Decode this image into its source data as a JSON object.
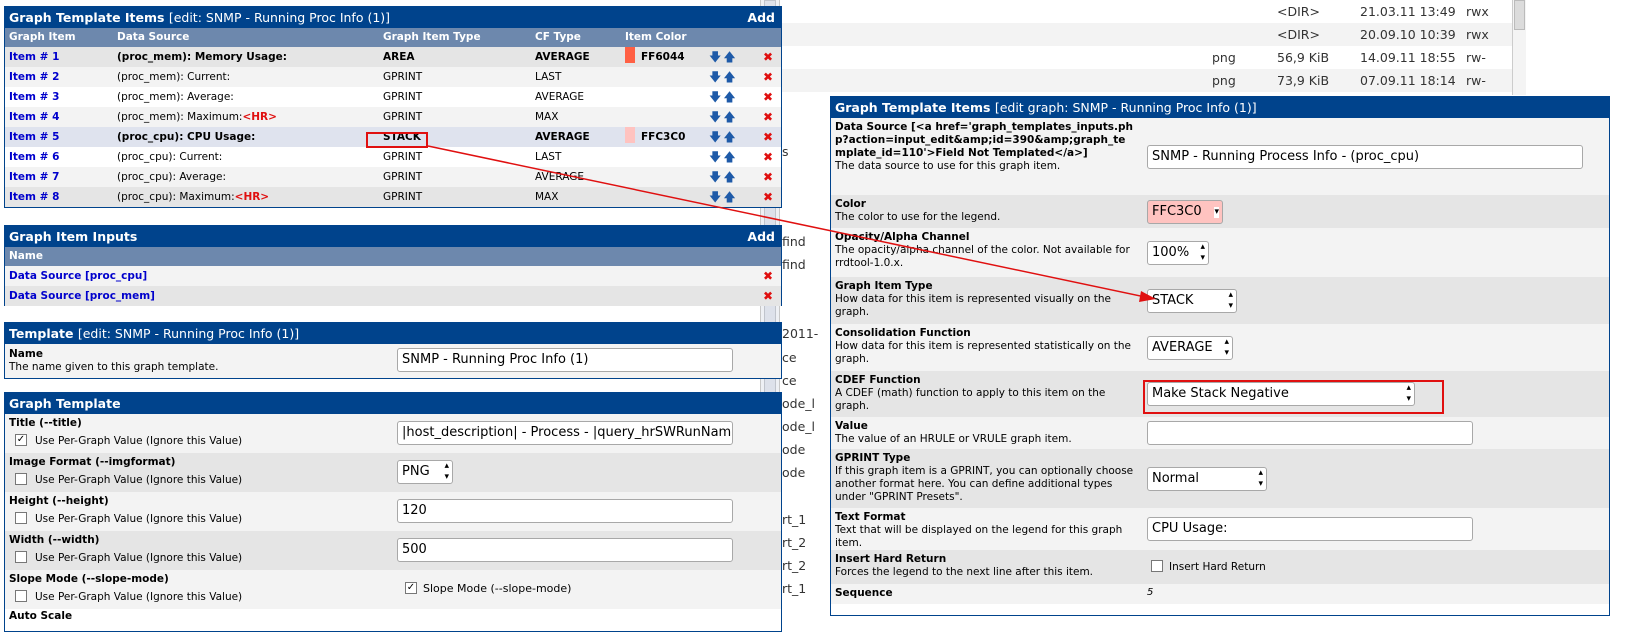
{
  "items_panel": {
    "title": "Graph Template Items",
    "subtitle": "[edit: SNMP - Running Proc Info (1)]",
    "add_label": "Add",
    "columns": [
      "Graph Item",
      "Data Source",
      "Graph Item Type",
      "CF Type",
      "Item Color"
    ],
    "rows": [
      {
        "item": "Item # 1",
        "source": "(proc_mem): Memory Usage:",
        "hr": "",
        "type": "AREA",
        "cf": "AVERAGE",
        "color": "FF6044",
        "swatch": "#ff6044"
      },
      {
        "item": "Item # 2",
        "source": "(proc_mem): Current:",
        "hr": "",
        "type": "GPRINT",
        "cf": "LAST",
        "color": "",
        "swatch": ""
      },
      {
        "item": "Item # 3",
        "source": "(proc_mem): Average:",
        "hr": "",
        "type": "GPRINT",
        "cf": "AVERAGE",
        "color": "",
        "swatch": ""
      },
      {
        "item": "Item # 4",
        "source": "(proc_mem): Maximum:",
        "hr": "<HR>",
        "type": "GPRINT",
        "cf": "MAX",
        "color": "",
        "swatch": ""
      },
      {
        "item": "Item # 5",
        "source": "(proc_cpu): CPU Usage:",
        "hr": "",
        "type": "STACK",
        "cf": "AVERAGE",
        "color": "FFC3C0",
        "swatch": "#ffc3c0"
      },
      {
        "item": "Item # 6",
        "source": "(proc_cpu): Current:",
        "hr": "",
        "type": "GPRINT",
        "cf": "LAST",
        "color": "",
        "swatch": ""
      },
      {
        "item": "Item # 7",
        "source": "(proc_cpu): Average:",
        "hr": "",
        "type": "GPRINT",
        "cf": "AVERAGE",
        "color": "",
        "swatch": ""
      },
      {
        "item": "Item # 8",
        "source": "(proc_cpu): Maximum:",
        "hr": "<HR>",
        "type": "GPRINT",
        "cf": "MAX",
        "color": "",
        "swatch": ""
      }
    ]
  },
  "inputs_panel": {
    "title": "Graph Item Inputs",
    "add_label": "Add",
    "col_name": "Name",
    "rows": [
      "Data Source [proc_cpu]",
      "Data Source [proc_mem]"
    ]
  },
  "template_panel": {
    "title": "Template",
    "subtitle": "[edit: SNMP - Running Proc Info (1)]",
    "name_label": "Name",
    "name_desc": "The name given to this graph template.",
    "name_value": "SNMP - Running Proc Info (1)"
  },
  "graph_template_panel": {
    "title": "Graph Template",
    "use_per_graph": "Use Per-Graph Value (Ignore this Value)",
    "fields": [
      {
        "label": "Title (--title)",
        "checked": "✓",
        "value": "|host_description| - Process - |query_hrSWRunName"
      },
      {
        "label": "Image Format (--imgformat)",
        "checked": "",
        "value": "PNG"
      },
      {
        "label": "Height (--height)",
        "checked": "",
        "value": "120"
      },
      {
        "label": "Width (--width)",
        "checked": "",
        "value": "500"
      },
      {
        "label": "Slope Mode (--slope-mode)",
        "checked": "",
        "value": "Slope Mode (--slope-mode)"
      }
    ],
    "partial_label": "Auto Scale"
  },
  "background_files": {
    "rows": [
      {
        "ext": "",
        "size": "<DIR>",
        "date": "21.03.11 13:49",
        "perm": "rwx"
      },
      {
        "ext": "",
        "size": "<DIR>",
        "date": "20.09.10 10:39",
        "perm": "rwx"
      },
      {
        "ext": "png",
        "size": "56,9 KiB",
        "date": "14.09.11 18:55",
        "perm": "rw-"
      },
      {
        "ext": "png",
        "size": "73,9 KiB",
        "date": "07.09.11 18:14",
        "perm": "rw-"
      }
    ],
    "left_fragments": [
      "s",
      "find",
      "find",
      "2011-",
      "ce",
      "ce",
      "ode_l",
      "ode_l",
      "ode",
      "ode",
      "rt_1",
      "rt_2",
      "rt_2",
      "rt_1"
    ]
  },
  "edit_panel": {
    "title": "Graph Template Items",
    "subtitle": "[edit graph: SNMP - Running Proc Info (1)]",
    "fields": [
      {
        "label": "Data Source [<a href='graph_templates_inputs.php?action=input_edit&amp;id=390&amp;graph_template_id=110'>Field Not Templated</a>]",
        "desc": "The data source to use for this graph item.",
        "value": "SNMP - Running Process Info - (proc_cpu)"
      },
      {
        "label": "Color",
        "desc": "The color to use for the legend.",
        "value": "FFC3C0"
      },
      {
        "label": "Opacity/Alpha Channel",
        "desc": "The opacity/alpha channel of the color. Not available for rrdtool-1.0.x.",
        "value": "100%"
      },
      {
        "label": "Graph Item Type",
        "desc": "How data for this item is represented visually on the graph.",
        "value": "STACK"
      },
      {
        "label": "Consolidation Function",
        "desc": "How data for this item is represented statistically on the graph.",
        "value": "AVERAGE"
      },
      {
        "label": "CDEF Function",
        "desc": "A CDEF (math) function to apply to this item on the graph.",
        "value": "Make Stack Negative"
      },
      {
        "label": "Value",
        "desc": "The value of an HRULE or VRULE graph item.",
        "value": ""
      },
      {
        "label": "GPRINT Type",
        "desc": "If this graph item is a GPRINT, you can optionally choose another format here. You can define additional types under \"GPRINT Presets\".",
        "value": "Normal"
      },
      {
        "label": "Text Format",
        "desc": "Text that will be displayed on the legend for this graph item.",
        "value": "CPU Usage:"
      },
      {
        "label": "Insert Hard Return",
        "desc": "Forces the legend to the next line after this item.",
        "value": "Insert Hard Return"
      },
      {
        "label": "Sequence",
        "desc": "",
        "value": "5"
      }
    ]
  },
  "colors": {
    "header": "#00438c",
    "colhead": "#6d88ad",
    "link": "#0000cc",
    "delete": "#e01010",
    "annotation": "#e01010"
  },
  "icons": [
    "arrow-down-icon",
    "arrow-up-icon",
    "delete-x-icon",
    "checkbox-icon",
    "select-updown-icon",
    "splitter-grip-icon"
  ]
}
